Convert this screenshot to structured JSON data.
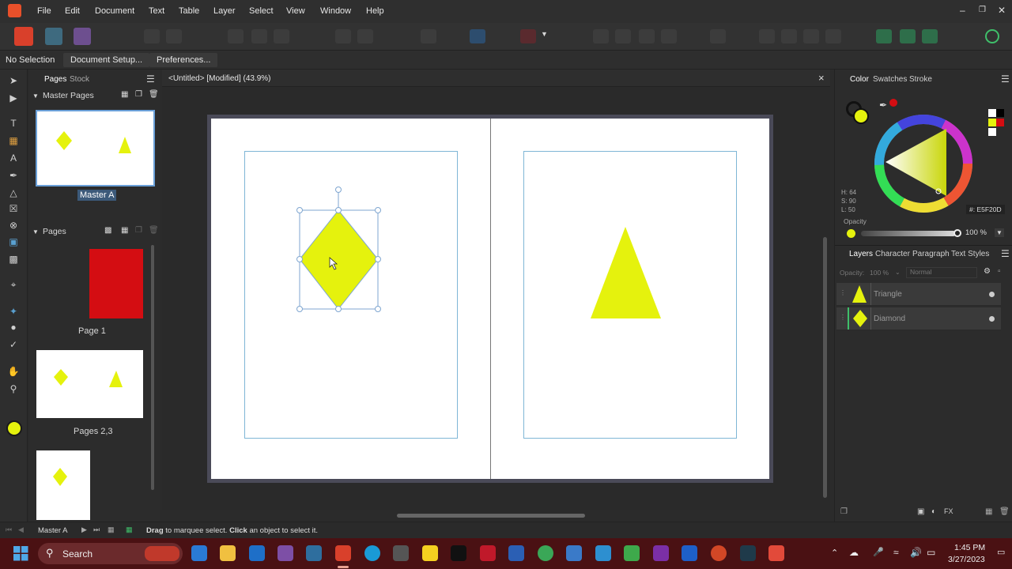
{
  "menu": [
    "File",
    "Edit",
    "Document",
    "Text",
    "Table",
    "Layer",
    "Select",
    "View",
    "Window",
    "Help"
  ],
  "context": {
    "selection": "No Selection",
    "doc_setup": "Document Setup...",
    "preferences": "Preferences..."
  },
  "pages_panel": {
    "tabs": [
      "Pages",
      "Stock"
    ],
    "master_section": "Master Pages",
    "master_label": "Master A",
    "pages_section": "Pages",
    "page1_label": "Page 1",
    "pages23_label": "Pages 2,3"
  },
  "document": {
    "tab_title": "<Untitled> [Modified] (43.9%)",
    "close": "×"
  },
  "color_panel": {
    "tabs": [
      "Color",
      "Swatches",
      "Stroke"
    ],
    "h": "H: 64",
    "s": "S: 90",
    "l": "L: 50",
    "hex": "#: E5F20D",
    "opacity_label": "Opacity",
    "opacity_value": "100 %",
    "fill_color": "#E5F20D"
  },
  "layers_panel": {
    "tabs": [
      "Layers",
      "Character",
      "Paragraph",
      "Text Styles"
    ],
    "opacity_label": "Opacity:",
    "opacity_value": "100 %",
    "blend_mode": "Normal",
    "layers": [
      "Triangle",
      "Diamond"
    ]
  },
  "status": {
    "page_name": "Master A",
    "drag": "Drag",
    "drag_text": " to marquee select. ",
    "click": "Click",
    "click_text": " an object to select it."
  },
  "taskbar": {
    "search": "Search",
    "time": "1:45 PM",
    "date": "3/27/2023"
  },
  "colors": {
    "shape": "#E5F20D",
    "page1": "#D40D12",
    "accent": "#3b6cb0"
  }
}
